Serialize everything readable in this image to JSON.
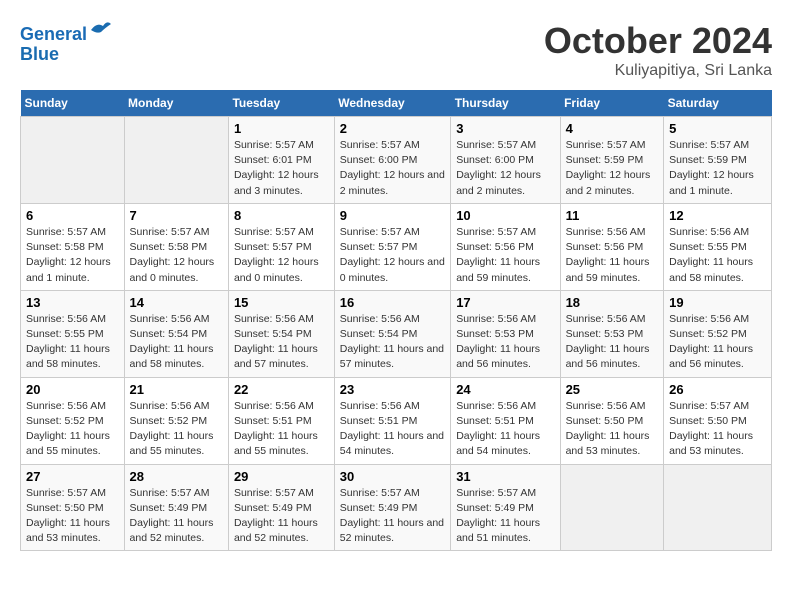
{
  "header": {
    "logo_line1": "General",
    "logo_line2": "Blue",
    "title": "October 2024",
    "subtitle": "Kuliyapitiya, Sri Lanka"
  },
  "weekdays": [
    "Sunday",
    "Monday",
    "Tuesday",
    "Wednesday",
    "Thursday",
    "Friday",
    "Saturday"
  ],
  "weeks": [
    [
      {
        "day": "",
        "empty": true
      },
      {
        "day": "",
        "empty": true
      },
      {
        "day": "1",
        "sunrise": "Sunrise: 5:57 AM",
        "sunset": "Sunset: 6:01 PM",
        "daylight": "Daylight: 12 hours and 3 minutes."
      },
      {
        "day": "2",
        "sunrise": "Sunrise: 5:57 AM",
        "sunset": "Sunset: 6:00 PM",
        "daylight": "Daylight: 12 hours and 2 minutes."
      },
      {
        "day": "3",
        "sunrise": "Sunrise: 5:57 AM",
        "sunset": "Sunset: 6:00 PM",
        "daylight": "Daylight: 12 hours and 2 minutes."
      },
      {
        "day": "4",
        "sunrise": "Sunrise: 5:57 AM",
        "sunset": "Sunset: 5:59 PM",
        "daylight": "Daylight: 12 hours and 2 minutes."
      },
      {
        "day": "5",
        "sunrise": "Sunrise: 5:57 AM",
        "sunset": "Sunset: 5:59 PM",
        "daylight": "Daylight: 12 hours and 1 minute."
      }
    ],
    [
      {
        "day": "6",
        "sunrise": "Sunrise: 5:57 AM",
        "sunset": "Sunset: 5:58 PM",
        "daylight": "Daylight: 12 hours and 1 minute."
      },
      {
        "day": "7",
        "sunrise": "Sunrise: 5:57 AM",
        "sunset": "Sunset: 5:58 PM",
        "daylight": "Daylight: 12 hours and 0 minutes."
      },
      {
        "day": "8",
        "sunrise": "Sunrise: 5:57 AM",
        "sunset": "Sunset: 5:57 PM",
        "daylight": "Daylight: 12 hours and 0 minutes."
      },
      {
        "day": "9",
        "sunrise": "Sunrise: 5:57 AM",
        "sunset": "Sunset: 5:57 PM",
        "daylight": "Daylight: 12 hours and 0 minutes."
      },
      {
        "day": "10",
        "sunrise": "Sunrise: 5:57 AM",
        "sunset": "Sunset: 5:56 PM",
        "daylight": "Daylight: 11 hours and 59 minutes."
      },
      {
        "day": "11",
        "sunrise": "Sunrise: 5:56 AM",
        "sunset": "Sunset: 5:56 PM",
        "daylight": "Daylight: 11 hours and 59 minutes."
      },
      {
        "day": "12",
        "sunrise": "Sunrise: 5:56 AM",
        "sunset": "Sunset: 5:55 PM",
        "daylight": "Daylight: 11 hours and 58 minutes."
      }
    ],
    [
      {
        "day": "13",
        "sunrise": "Sunrise: 5:56 AM",
        "sunset": "Sunset: 5:55 PM",
        "daylight": "Daylight: 11 hours and 58 minutes."
      },
      {
        "day": "14",
        "sunrise": "Sunrise: 5:56 AM",
        "sunset": "Sunset: 5:54 PM",
        "daylight": "Daylight: 11 hours and 58 minutes."
      },
      {
        "day": "15",
        "sunrise": "Sunrise: 5:56 AM",
        "sunset": "Sunset: 5:54 PM",
        "daylight": "Daylight: 11 hours and 57 minutes."
      },
      {
        "day": "16",
        "sunrise": "Sunrise: 5:56 AM",
        "sunset": "Sunset: 5:54 PM",
        "daylight": "Daylight: 11 hours and 57 minutes."
      },
      {
        "day": "17",
        "sunrise": "Sunrise: 5:56 AM",
        "sunset": "Sunset: 5:53 PM",
        "daylight": "Daylight: 11 hours and 56 minutes."
      },
      {
        "day": "18",
        "sunrise": "Sunrise: 5:56 AM",
        "sunset": "Sunset: 5:53 PM",
        "daylight": "Daylight: 11 hours and 56 minutes."
      },
      {
        "day": "19",
        "sunrise": "Sunrise: 5:56 AM",
        "sunset": "Sunset: 5:52 PM",
        "daylight": "Daylight: 11 hours and 56 minutes."
      }
    ],
    [
      {
        "day": "20",
        "sunrise": "Sunrise: 5:56 AM",
        "sunset": "Sunset: 5:52 PM",
        "daylight": "Daylight: 11 hours and 55 minutes."
      },
      {
        "day": "21",
        "sunrise": "Sunrise: 5:56 AM",
        "sunset": "Sunset: 5:52 PM",
        "daylight": "Daylight: 11 hours and 55 minutes."
      },
      {
        "day": "22",
        "sunrise": "Sunrise: 5:56 AM",
        "sunset": "Sunset: 5:51 PM",
        "daylight": "Daylight: 11 hours and 55 minutes."
      },
      {
        "day": "23",
        "sunrise": "Sunrise: 5:56 AM",
        "sunset": "Sunset: 5:51 PM",
        "daylight": "Daylight: 11 hours and 54 minutes."
      },
      {
        "day": "24",
        "sunrise": "Sunrise: 5:56 AM",
        "sunset": "Sunset: 5:51 PM",
        "daylight": "Daylight: 11 hours and 54 minutes."
      },
      {
        "day": "25",
        "sunrise": "Sunrise: 5:56 AM",
        "sunset": "Sunset: 5:50 PM",
        "daylight": "Daylight: 11 hours and 53 minutes."
      },
      {
        "day": "26",
        "sunrise": "Sunrise: 5:57 AM",
        "sunset": "Sunset: 5:50 PM",
        "daylight": "Daylight: 11 hours and 53 minutes."
      }
    ],
    [
      {
        "day": "27",
        "sunrise": "Sunrise: 5:57 AM",
        "sunset": "Sunset: 5:50 PM",
        "daylight": "Daylight: 11 hours and 53 minutes."
      },
      {
        "day": "28",
        "sunrise": "Sunrise: 5:57 AM",
        "sunset": "Sunset: 5:49 PM",
        "daylight": "Daylight: 11 hours and 52 minutes."
      },
      {
        "day": "29",
        "sunrise": "Sunrise: 5:57 AM",
        "sunset": "Sunset: 5:49 PM",
        "daylight": "Daylight: 11 hours and 52 minutes."
      },
      {
        "day": "30",
        "sunrise": "Sunrise: 5:57 AM",
        "sunset": "Sunset: 5:49 PM",
        "daylight": "Daylight: 11 hours and 52 minutes."
      },
      {
        "day": "31",
        "sunrise": "Sunrise: 5:57 AM",
        "sunset": "Sunset: 5:49 PM",
        "daylight": "Daylight: 11 hours and 51 minutes."
      },
      {
        "day": "",
        "empty": true
      },
      {
        "day": "",
        "empty": true
      }
    ]
  ]
}
